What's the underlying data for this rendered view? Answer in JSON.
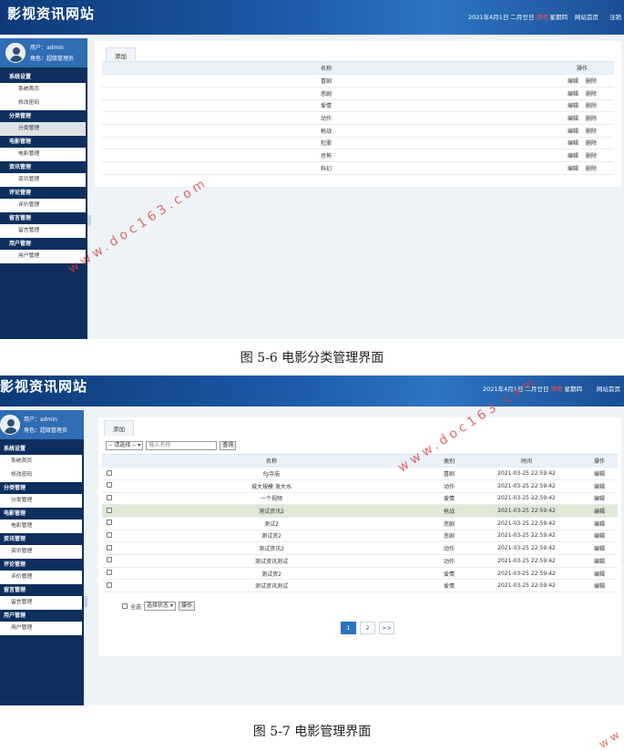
{
  "site_title": "影视资讯网站",
  "date_text": "2021年4月1日 二月廿日",
  "date_highlight": "清明",
  "weekday": "星期四",
  "date_text2": "2021年4月1日 二月廿日",
  "weekday2": "星期四",
  "top_links": {
    "home": "网站首页",
    "logout": "注销"
  },
  "user": {
    "name_label": "用户：admin",
    "role_label": "角色：超级管理员"
  },
  "sidebar": [
    {
      "category": "系统设置",
      "items": [
        "系统首页",
        "修改密码"
      ]
    },
    {
      "category": "分类管理",
      "items": [
        "分类管理"
      ]
    },
    {
      "category": "电影管理",
      "items": [
        "电影管理"
      ]
    },
    {
      "category": "资讯管理",
      "items": [
        "资讯管理"
      ]
    },
    {
      "category": "评论管理",
      "items": [
        "评价管理"
      ]
    },
    {
      "category": "留言管理",
      "items": [
        "留言管理"
      ]
    },
    {
      "category": "用户管理",
      "items": [
        "用户管理"
      ]
    }
  ],
  "add_tab": "添加",
  "category_table": {
    "headers": [
      "名称",
      "操作"
    ],
    "rows": [
      "喜剧",
      "悲剧",
      "爱情",
      "动作",
      "枪战",
      "犯罪",
      "恐怖",
      "科幻"
    ],
    "edit_label": "编辑",
    "delete_label": "删除"
  },
  "caption1": "图 5-6  电影分类管理界面",
  "caption2": "图 5-7 电影管理界面",
  "watermark1": "www.doc163.com",
  "watermark2": "www.doc163.com",
  "watermark3": "ww",
  "movie_toolbar": {
    "select_placeholder": "-- 请选择 --",
    "search_placeholder": "输入名称",
    "search_button": "查询"
  },
  "movie_table": {
    "headers": [
      "名称",
      "类别",
      "时间",
      "操作"
    ],
    "rows": [
      [
        "fg寺庙",
        "喜剧",
        "2021-03-25 22:59:42",
        "编辑"
      ],
      [
        "城大規模 发大水",
        "动作",
        "2021-03-25 22:59:42",
        "编辑"
      ],
      [
        "一个视频",
        "爱情",
        "2021-03-25 22:59:42",
        "编辑"
      ],
      [
        "测试资讯2",
        "枪战",
        "2021-03-25 22:59:42",
        "编辑"
      ],
      [
        "测试2",
        "悲剧",
        "2021-03-25 22:59:42",
        "编辑"
      ],
      [
        "测试资2",
        "悲剧",
        "2021-03-25 22:59:42",
        "编辑"
      ],
      [
        "测试资讯2",
        "动作",
        "2021-03-25 22:59:42",
        "编辑"
      ],
      [
        "测试资讯测试",
        "动作",
        "2021-03-25 22:59:42",
        "编辑"
      ],
      [
        "测试资2",
        "爱情",
        "2021-03-25 22:59:42",
        "编辑"
      ],
      [
        "测试资讯测试",
        "爱情",
        "2021-03-25 22:59:42",
        "编辑"
      ]
    ],
    "highlighted_row": 3
  },
  "bulk": {
    "select_all": "全选",
    "state_select": "选择状态",
    "action_button": "操作"
  },
  "pagination": [
    "1",
    "2",
    ">>"
  ]
}
